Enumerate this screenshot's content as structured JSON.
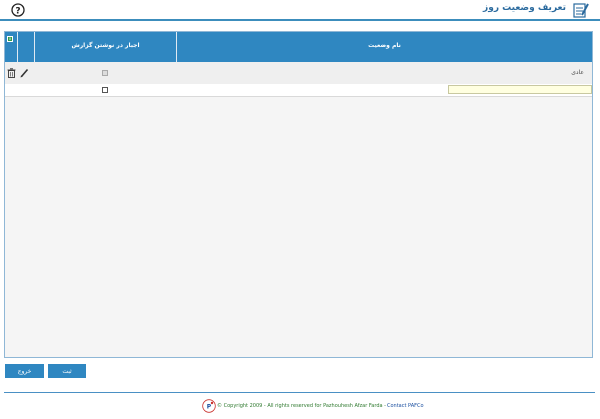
{
  "header": {
    "title": "تعریف وضعیت روز",
    "form_icon": "form-edit-icon",
    "help_icon": "help-circle-icon"
  },
  "grid": {
    "columns": [
      {
        "key": "name",
        "label": "نام وضعیت"
      },
      {
        "key": "require_report",
        "label": "اجبار در نوشتن گزارش"
      }
    ],
    "export_icon": "excel-icon",
    "rows": [
      {
        "name": "عادی",
        "require_report": false,
        "edit_icon": "pencil-icon",
        "delete_icon": "trash-icon"
      }
    ],
    "new_row": {
      "name_value": "",
      "require_report": false
    }
  },
  "buttons": {
    "save_label": "ثبت",
    "exit_label": "خروج"
  },
  "footer": {
    "copyright": "© Copyright 2009 - All rights reserved for Pazhouhesh Afzar Farda -",
    "contact": "Contact PAFCo",
    "logo_icon": "pafco-logo-icon"
  },
  "colors": {
    "accent": "#2f87c1",
    "input_bg": "#ffffe0"
  }
}
